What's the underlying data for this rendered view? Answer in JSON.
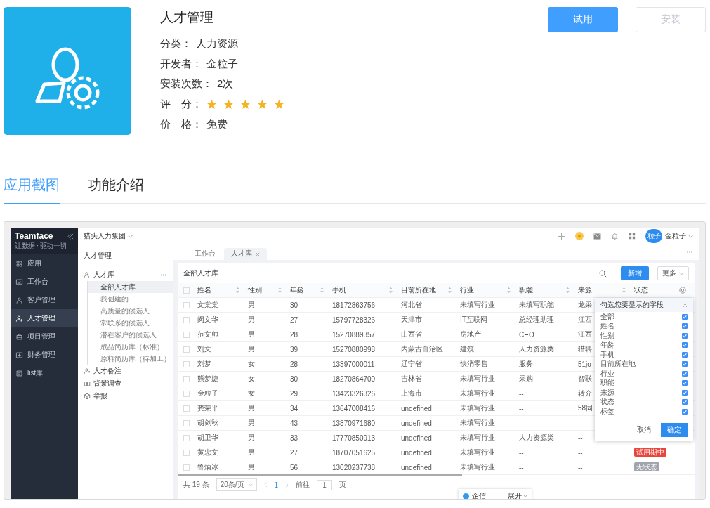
{
  "app": {
    "title": "人才管理",
    "fields": [
      {
        "kind": "text",
        "label": "分类：",
        "value": "人力资源"
      },
      {
        "kind": "text",
        "label": "开发者：",
        "value": "金粒子"
      },
      {
        "kind": "text",
        "label": "安装次数：",
        "value": "2次"
      },
      {
        "kind": "stars",
        "label": "评　分：",
        "stars": 5
      },
      {
        "kind": "text",
        "label": "价　格：",
        "value": "免费"
      }
    ],
    "actions": [
      {
        "label": "试用",
        "disabled": false
      },
      {
        "label": "安装",
        "disabled": true
      }
    ]
  },
  "tabs": [
    {
      "label": "应用截图",
      "selected": true
    },
    {
      "label": "功能介绍",
      "selected": false
    }
  ],
  "screenshot": {
    "brand": {
      "name": "Teamface",
      "tagline": "让数据 · 驱动一切"
    },
    "nav": [
      {
        "label": "应用",
        "selected": false
      },
      {
        "label": "工作台",
        "selected": false
      },
      {
        "label": "客户管理",
        "selected": false
      },
      {
        "label": "人才管理",
        "selected": true
      },
      {
        "label": "项目管理",
        "selected": false
      },
      {
        "label": "财务管理",
        "selected": false
      },
      {
        "label": "list库",
        "selected": false
      }
    ],
    "company": "猎头人力集团",
    "user": {
      "avatar": "粒子",
      "name": "金粒子"
    },
    "panel": {
      "title": "人才管理",
      "tree": [
        {
          "label": "人才库",
          "more": true,
          "children": [
            {
              "label": "全部人才库",
              "selected": true
            },
            {
              "label": "我创建的",
              "selected": false
            },
            {
              "label": "高质量的候选人",
              "selected": false
            },
            {
              "label": "常联系的候选人",
              "selected": false
            },
            {
              "label": "潜在客户的候选人",
              "selected": false
            },
            {
              "label": "成品简历库（标准）",
              "selected": false
            },
            {
              "label": "原料简历库（待加工）",
              "selected": false
            }
          ]
        },
        {
          "label": "人才备注",
          "more": false
        },
        {
          "label": "背景调查",
          "more": false
        },
        {
          "label": "举报",
          "more": false
        }
      ]
    },
    "page_tabs": [
      {
        "label": "工作台",
        "selected": false,
        "closable": false
      },
      {
        "label": "人才库",
        "selected": true,
        "closable": true
      }
    ],
    "list_title": "全部人才库",
    "add_button": "新增",
    "more_button": "更多",
    "table": {
      "all_checked": false,
      "columns": [
        {
          "label": "姓名",
          "sortable": true
        },
        {
          "label": "性别",
          "sortable": true
        },
        {
          "label": "年龄",
          "sortable": true
        },
        {
          "label": "手机",
          "sortable": true
        },
        {
          "label": "目前所在地",
          "sortable": true
        },
        {
          "label": "行业",
          "sortable": true
        },
        {
          "label": "职能",
          "sortable": true
        },
        {
          "label": "来源",
          "sortable": true
        },
        {
          "label": "状态",
          "sortable": false
        }
      ],
      "rows": [
        {
          "checked": false,
          "cells": [
            "文棠棠",
            "男",
            "30",
            "18172863756",
            "河北省",
            "未填写行业",
            "未填写职能",
            "龙采"
          ]
        },
        {
          "checked": false,
          "cells": [
            "闵文华",
            "男",
            "27",
            "15797728326",
            "天津市",
            "IT互联网",
            "总经理助理",
            "江西"
          ]
        },
        {
          "checked": false,
          "cells": [
            "范文帅",
            "男",
            "28",
            "15270889357",
            "山西省",
            "房地产",
            "CEO",
            "江西"
          ]
        },
        {
          "checked": false,
          "cells": [
            "刘文",
            "男",
            "39",
            "15270880998",
            "内蒙古自治区",
            "建筑",
            "人力资源类",
            "猎聘"
          ]
        },
        {
          "checked": false,
          "cells": [
            "刘梦",
            "女",
            "28",
            "13397000011",
            "辽宁省",
            "快消零售",
            "服务",
            "51jo"
          ]
        },
        {
          "checked": false,
          "cells": [
            "熊梦婕",
            "女",
            "30",
            "18270864700",
            "吉林省",
            "未填写行业",
            "采购",
            "智联"
          ]
        },
        {
          "checked": false,
          "cells": [
            "金粒子",
            "女",
            "29",
            "13423326326",
            "上海市",
            "未填写行业",
            "--",
            "转介"
          ]
        },
        {
          "checked": false,
          "cells": [
            "龚荣平",
            "男",
            "34",
            "13647008416",
            "undefined",
            "未填写行业",
            "--",
            "58同"
          ]
        },
        {
          "checked": false,
          "cells": [
            "胡剑秋",
            "男",
            "43",
            "13870971680",
            "undefined",
            "未填写行业",
            "--",
            "--"
          ]
        },
        {
          "checked": false,
          "cells": [
            "胡卫华",
            "男",
            "33",
            "17770850913",
            "undefined",
            "未填写行业",
            "人力资源类",
            "--"
          ]
        },
        {
          "checked": false,
          "cells": [
            "黄忠文",
            "男",
            "27",
            "18707051625",
            "undefined",
            "未填写行业",
            "--",
            "--"
          ],
          "status": {
            "label": "试用期中",
            "color": "#e8453c"
          }
        },
        {
          "checked": false,
          "cells": [
            "鲁炳冰",
            "男",
            "56",
            "13020237738",
            "undefined",
            "未填写行业",
            "--",
            "--"
          ],
          "status": {
            "label": "无状态",
            "color": "#a0a4ad"
          }
        }
      ]
    },
    "field_picker": {
      "title": "勾选您要显示的字段",
      "fields": [
        {
          "label": "全部",
          "checked": true
        },
        {
          "label": "姓名",
          "checked": true
        },
        {
          "label": "性别",
          "checked": true
        },
        {
          "label": "年龄",
          "checked": true
        },
        {
          "label": "手机",
          "checked": true
        },
        {
          "label": "目前所在地",
          "checked": true
        },
        {
          "label": "行业",
          "checked": true
        },
        {
          "label": "职能",
          "checked": true
        },
        {
          "label": "来源",
          "checked": true
        },
        {
          "label": "状态",
          "checked": true
        },
        {
          "label": "标签",
          "checked": true
        }
      ],
      "cancel": "取消",
      "confirm": "确定"
    },
    "pagination": {
      "total": "共 19 条",
      "page_size": "20条/页",
      "current": "1",
      "goto_label": "前往",
      "goto_value": "1",
      "goto_unit": "页"
    },
    "chat": {
      "label": "企信",
      "expand": "展开"
    }
  }
}
